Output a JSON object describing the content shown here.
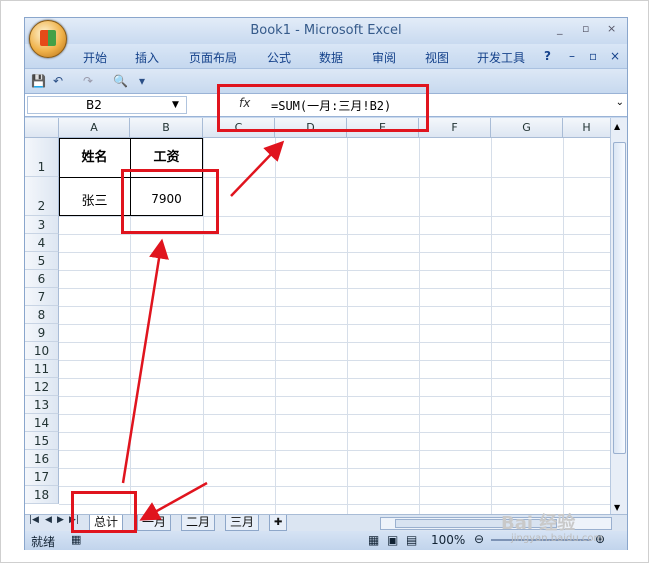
{
  "window": {
    "title": "Book1 - Microsoft Excel",
    "controls": [
      "_",
      "▫",
      "×"
    ]
  },
  "ribbon": {
    "tabs": [
      "开始",
      "插入",
      "页面布局",
      "公式",
      "数据",
      "审阅",
      "视图",
      "开发工具"
    ],
    "help_icon": "help-icon"
  },
  "formula_bar": {
    "name_box": "B2",
    "fx_label": "fx",
    "formula": "=SUM(一月:三月!B2)"
  },
  "grid": {
    "columns": [
      "A",
      "B",
      "C",
      "D",
      "E",
      "F",
      "G",
      "H"
    ],
    "rows": [
      "1",
      "2",
      "3",
      "4",
      "5",
      "6",
      "7",
      "8",
      "9",
      "10",
      "11",
      "12",
      "13",
      "14",
      "15",
      "16",
      "17",
      "18"
    ],
    "cells": {
      "A1": "姓名",
      "B1": "工资",
      "A2": "张三",
      "B2": "7900"
    }
  },
  "sheets": {
    "tabs": [
      "总计",
      "一月",
      "二月",
      "三月"
    ],
    "active": "总计"
  },
  "status_bar": {
    "mode": "就绪",
    "zoom": "100%"
  },
  "watermark": {
    "brand": "Bai 经验",
    "url": "jingyan.baidu.com"
  },
  "colors": {
    "annotation": "#e0141e",
    "ribbon_text": "#15428b"
  }
}
